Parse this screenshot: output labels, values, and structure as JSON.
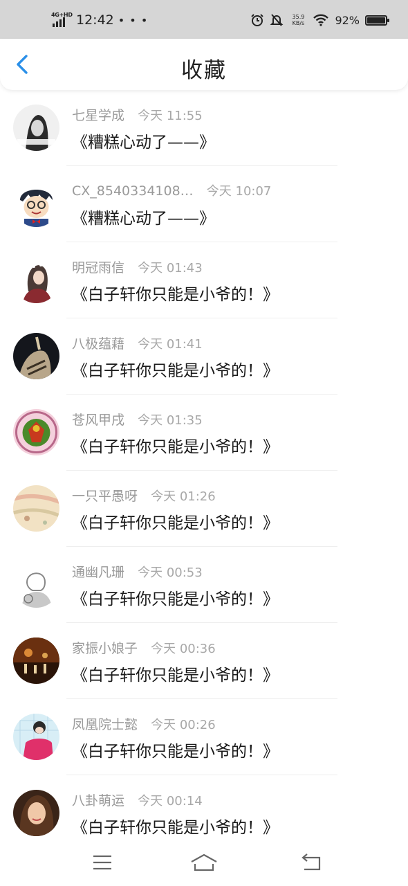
{
  "status_bar": {
    "network": "4G+HD",
    "time": "12:42",
    "more": "• • •",
    "speed_value": "35.9",
    "speed_unit": "KB/s",
    "battery": "92%",
    "battery_level": 0.92,
    "icons": [
      "signal-icon",
      "alarm-icon",
      "mute-icon",
      "wifi-icon",
      "battery-icon"
    ]
  },
  "header": {
    "title": "收藏",
    "back_icon": "back-arrow-icon",
    "accent": "#2a8fe8"
  },
  "favorites": [
    {
      "user": "七星学成",
      "time": "今天 11:55",
      "title": "《糟糕心动了——》"
    },
    {
      "user": "CX_8540334108…",
      "time": "今天 10:07",
      "title": "《糟糕心动了——》"
    },
    {
      "user": "明冠雨信",
      "time": "今天 01:43",
      "title": "《白子轩你只能是小爷的！》"
    },
    {
      "user": "八极蕴藉",
      "time": "今天 01:41",
      "title": "《白子轩你只能是小爷的！》"
    },
    {
      "user": "苍风甲戌",
      "time": "今天 01:35",
      "title": "《白子轩你只能是小爷的！》"
    },
    {
      "user": "一只平愚呀",
      "time": "今天 01:26",
      "title": "《白子轩你只能是小爷的！》"
    },
    {
      "user": "通幽凡珊",
      "time": "今天 00:53",
      "title": "《白子轩你只能是小爷的！》"
    },
    {
      "user": "家振小娘子",
      "time": "今天 00:36",
      "title": "《白子轩你只能是小爷的！》"
    },
    {
      "user": "凤凰院士懿",
      "time": "今天 00:26",
      "title": "《白子轩你只能是小爷的！》"
    },
    {
      "user": "八卦萌运",
      "time": "今天 00:14",
      "title": "《白子轩你只能是小爷的！》"
    }
  ],
  "bottom_nav": {
    "icons": [
      "menu-icon",
      "home-icon",
      "back-icon"
    ]
  }
}
